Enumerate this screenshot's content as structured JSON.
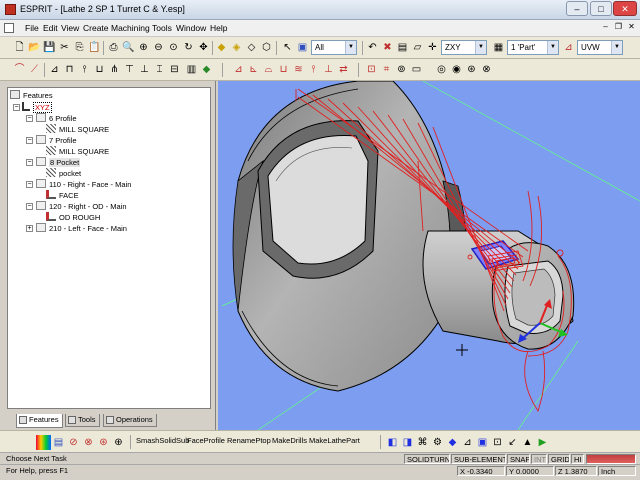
{
  "window": {
    "title": "ESPRIT - [Lathe 2 SP 1 Turret C & Y.esp]",
    "minimize": "–",
    "maximize": "□",
    "close": "✕"
  },
  "menubar": {
    "items": [
      "File",
      "Edit",
      "View",
      "Create",
      "Machining",
      "Tools",
      "Window",
      "Help"
    ],
    "mdi_minimize": "–",
    "mdi_restore": "❐",
    "mdi_close": "✕"
  },
  "toolbar1": {
    "filter_value": "All",
    "plane_value": "ZXY",
    "part_value": "1 'Part'",
    "axis_value": "UVW"
  },
  "features_tree": {
    "root": "Features",
    "workplane": "XYZ",
    "nodes": [
      {
        "label": "6 Profile",
        "level": 1
      },
      {
        "label": "MILL SQUARE",
        "level": 2
      },
      {
        "label": "7 Profile",
        "level": 1
      },
      {
        "label": "MILL SQUARE",
        "level": 2
      },
      {
        "label": "8 Pocket",
        "level": 1
      },
      {
        "label": "pocket",
        "level": 2
      },
      {
        "label": "110 - Right - Face - Main",
        "level": 1
      },
      {
        "label": "FACE",
        "level": 2
      },
      {
        "label": "120 - Right - OD - Main",
        "level": 1
      },
      {
        "label": "OD ROUGH",
        "level": 2
      },
      {
        "label": "210 - Left - Face - Main",
        "level": 1
      }
    ]
  },
  "panel_tabs": [
    "Features",
    "Tools",
    "Operations"
  ],
  "bottom_buttons": [
    "SmashSolidSub",
    "FaceProfile",
    "RenamePtop",
    "MakeDrills",
    "MakeLathePart"
  ],
  "status": {
    "task": "Choose Next Task",
    "help": "For Help, press F1",
    "modes": [
      "SOLIDTURN",
      "SUB-ELEMENTS",
      "SNAP",
      "INT",
      "GRID",
      "HI"
    ],
    "x": "X -0.3340",
    "y": "Y 0.0000",
    "z": "Z 1.3870",
    "units": "Inch"
  },
  "colors": {
    "viewport": "#7d9df0",
    "solid": "#a8a8a8",
    "toolpath": "#e02020",
    "axis_x": "#e02020",
    "axis_y": "#20c020",
    "axis_z": "#2030e0"
  }
}
